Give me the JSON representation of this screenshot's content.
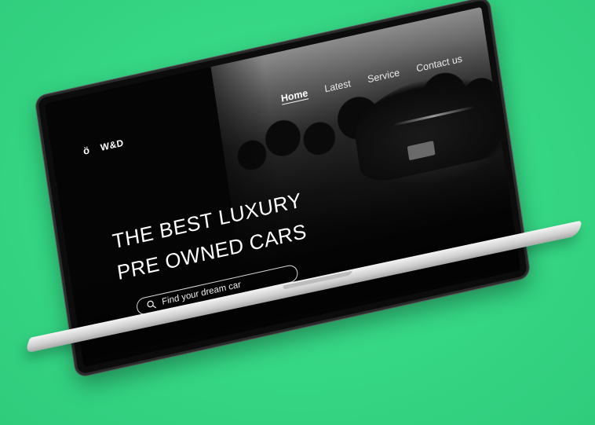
{
  "brand": {
    "logo_glyph": "ö",
    "name": "W&D"
  },
  "nav": {
    "items": [
      {
        "label": "Home",
        "active": true
      },
      {
        "label": "Latest"
      },
      {
        "label": "Service"
      },
      {
        "label": "Contact us"
      }
    ]
  },
  "hero": {
    "headline_line1": "THE BEST LUXURY",
    "headline_line2": "PRE OWNED CARS"
  },
  "search": {
    "placeholder": "Find your dream car"
  },
  "colors": {
    "background": "#35d684",
    "screen": "#050505",
    "text": "#ffffff"
  }
}
